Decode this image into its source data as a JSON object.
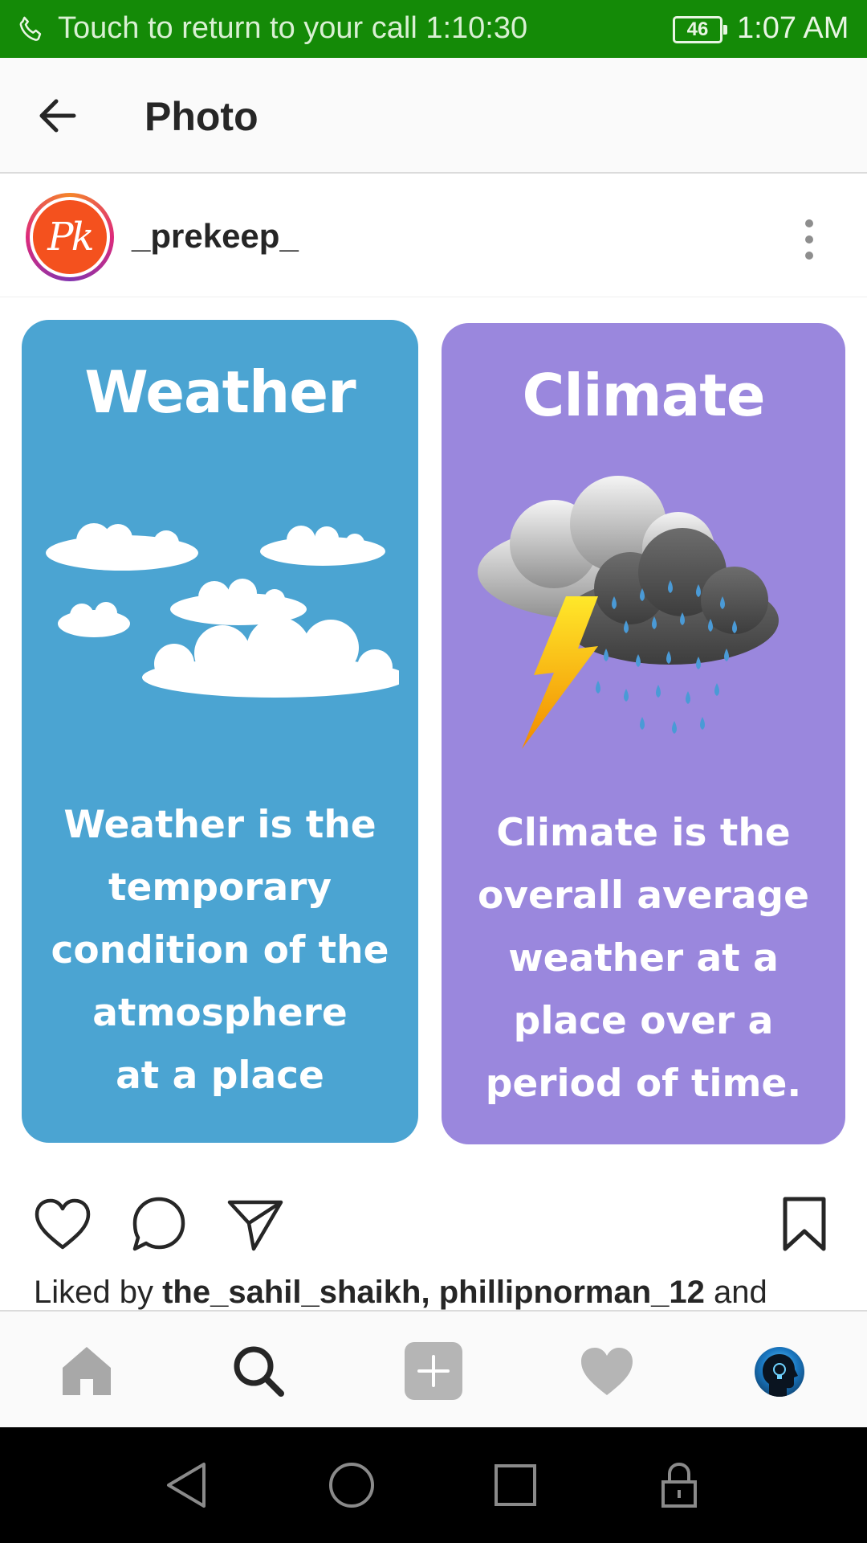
{
  "status_bar": {
    "call_text": "Touch to return to your call 1:10:30",
    "battery": "46",
    "time": "1:07 AM",
    "background_color": "#148a07"
  },
  "header": {
    "title": "Photo",
    "back_icon": "arrow-left-icon"
  },
  "post": {
    "avatar_text": "Pk",
    "username": "_prekeep_",
    "more_icon": "more-vertical-icon"
  },
  "cards": {
    "weather": {
      "title": "Weather",
      "body": "Weather is the\ntemporary\ncondition of the\natmosphere\nat a place",
      "color": "#4ba4d2"
    },
    "climate": {
      "title": "Climate",
      "body": "Climate is the\noverall average\nweather at a\nplace over a\nperiod of time.",
      "color": "#9a87dd"
    }
  },
  "actions": {
    "icons": [
      "heart-icon",
      "comment-icon",
      "share-icon",
      "bookmark-icon"
    ]
  },
  "likes": {
    "prefix": "Liked by ",
    "user1": "the_sahil_shaikh",
    "separator": ", ",
    "user2": "phillipnorman_12",
    "suffix": " and"
  },
  "bottom_nav": {
    "icons": [
      "home-icon",
      "search-icon",
      "add-post-icon",
      "activity-heart-icon",
      "profile-avatar"
    ]
  },
  "system_nav": {
    "icons": [
      "back-triangle-icon",
      "home-circle-icon",
      "recents-square-icon",
      "lock-icon"
    ]
  }
}
